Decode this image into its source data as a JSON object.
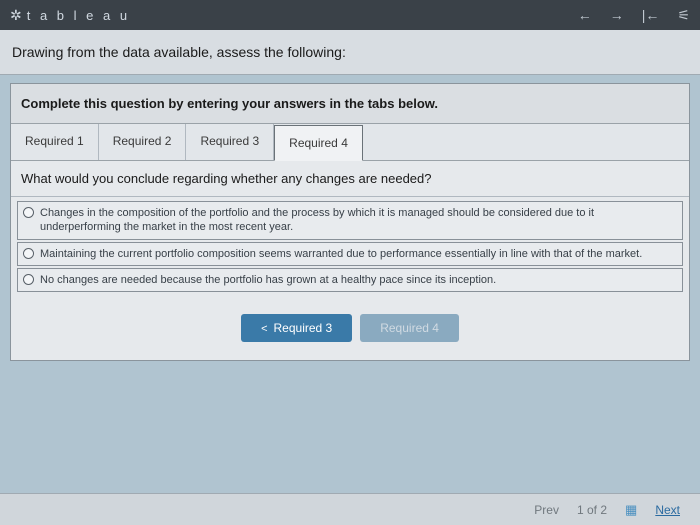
{
  "topbar": {
    "brand": "t a b l e a u",
    "brand_icon": "✲"
  },
  "prompt": "Drawing from the data available, assess the following:",
  "instruction": "Complete this question by entering your answers in the tabs below.",
  "tabs": [
    {
      "label": "Required 1"
    },
    {
      "label": "Required 2"
    },
    {
      "label": "Required 3"
    },
    {
      "label": "Required 4"
    }
  ],
  "question": "What would you conclude regarding whether any changes are needed?",
  "options": [
    "Changes in the composition of the portfolio and the process by which it is managed should be considered due to it underperforming the market in the most recent year.",
    "Maintaining the current portfolio composition seems warranted due to performance essentially in line with that of the market.",
    "No changes are needed because the portfolio has grown at a healthy pace since its inception."
  ],
  "nav": {
    "prev": "Required 3",
    "next": "Required 4"
  },
  "footer": {
    "prev": "Prev",
    "page": "1 of 2",
    "next": "Next"
  }
}
